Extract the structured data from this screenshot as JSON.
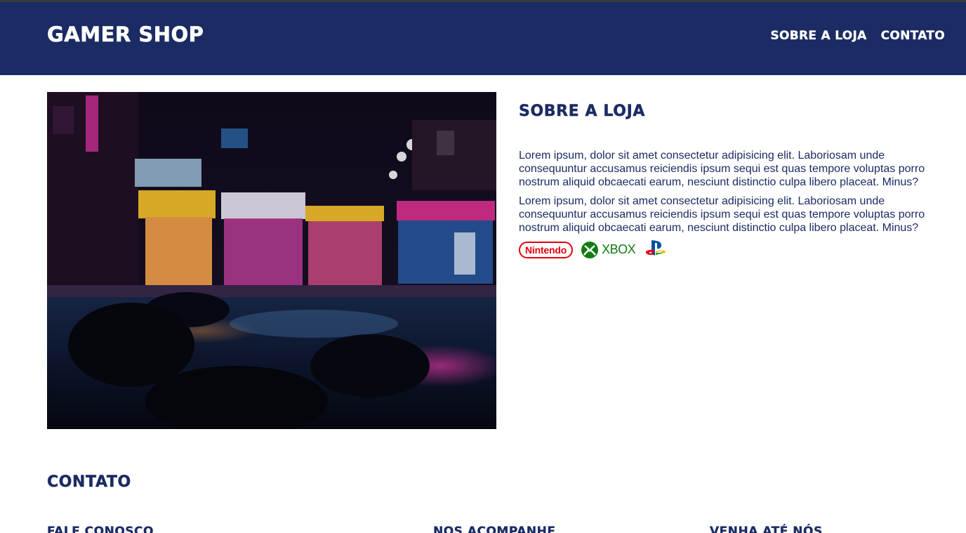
{
  "header": {
    "logo": "Gamer Shop",
    "nav": [
      "Sobre a loja",
      "Contato"
    ]
  },
  "about": {
    "title": "Sobre a loja",
    "paragraphs": [
      "Lorem ipsum, dolor sit amet consectetur adipisicing elit. Laboriosam unde consequuntur accusamus reiciendis ipsum sequi est quas tempore voluptas porro nostrum aliquid obcaecati earum, nesciunt distinctio culpa libero placeat. Minus?",
      "Lorem ipsum, dolor sit amet consectetur adipisicing elit. Laboriosam unde consequuntur accusamus reiciendis ipsum sequi est quas tempore voluptas porro nostrum aliquid obcaecati earum, nesciunt distinctio culpa libero placeat. Minus?"
    ]
  },
  "brands": {
    "nintendo": "Nintendo",
    "xbox": "XBOX",
    "icons": [
      "nintendo-logo",
      "xbox-logo",
      "playstation-logo"
    ]
  },
  "contact": {
    "title": "Contato",
    "columns": [
      "Fale conosco",
      "Nos acompanhe",
      "Venha até nós"
    ]
  },
  "colors": {
    "header_bg": "#1b2b63",
    "text": "#1b2b63",
    "nintendo_red": "#e4000f",
    "xbox_green": "#107c10"
  }
}
